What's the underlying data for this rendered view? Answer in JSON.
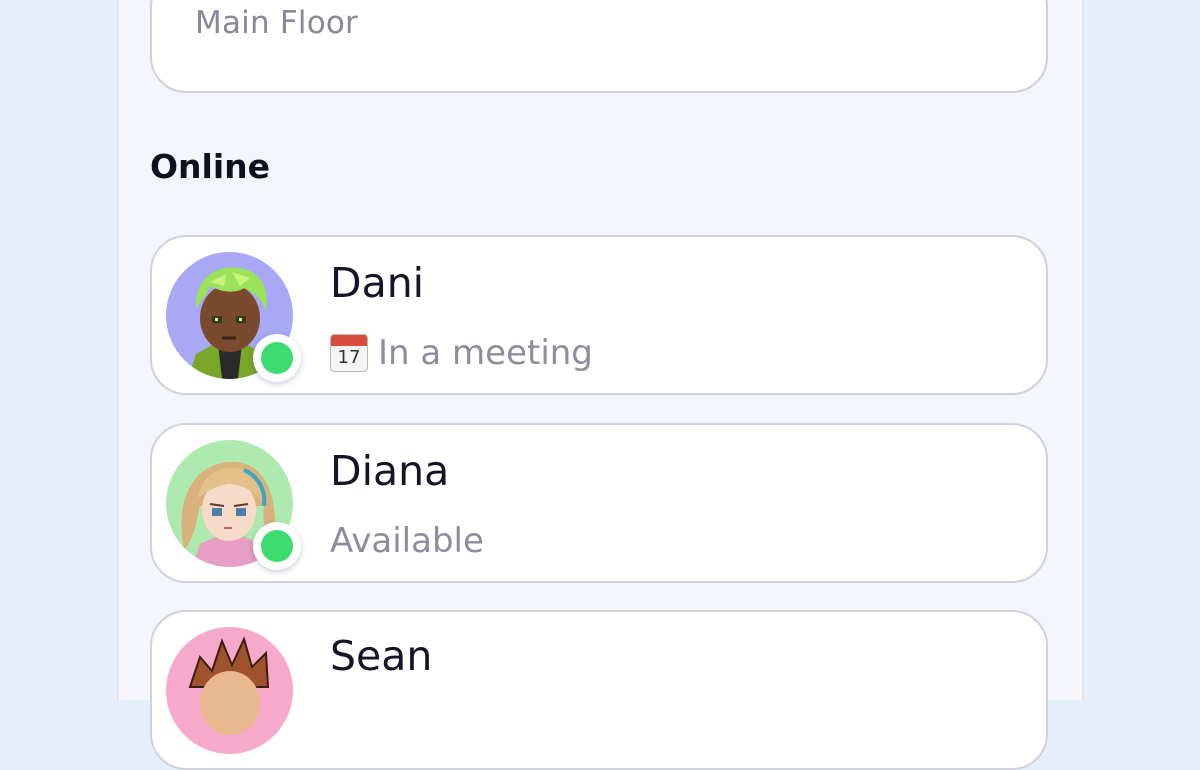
{
  "location": {
    "value": "Main Floor"
  },
  "online_section": {
    "title": "Online"
  },
  "members": [
    {
      "name": "Dani",
      "status_icon": "calendar-icon",
      "calendar_day": "17",
      "status": "In a meeting",
      "presence": "online",
      "presence_color": "#3ddc6e",
      "avatar_bg": "#a9a8f4"
    },
    {
      "name": "Diana",
      "status": "Available",
      "presence": "online",
      "presence_color": "#3ddc6e",
      "avatar_bg": "#aeeab0"
    },
    {
      "name": "Sean",
      "avatar_bg": "#f6a9c9"
    }
  ],
  "colors": {
    "page_bg": "#e6f0fd",
    "panel_bg": "#f4f6fb",
    "card_bg": "#ffffff",
    "text_primary": "#141529",
    "text_secondary": "#8c8e9f"
  }
}
